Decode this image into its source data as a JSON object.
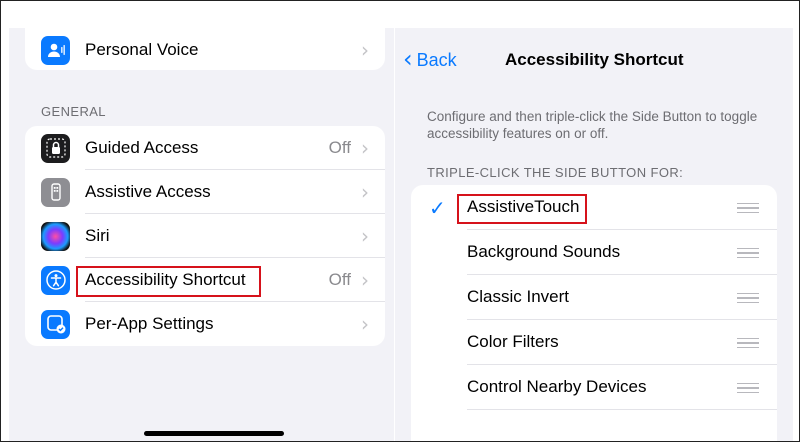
{
  "left": {
    "top_row": {
      "label": "Personal Voice",
      "icon": "personal-voice-icon"
    },
    "section_title": "GENERAL",
    "rows": [
      {
        "label": "Guided Access",
        "value": "Off",
        "icon": "lock-icon"
      },
      {
        "label": "Assistive Access",
        "value": "",
        "icon": "assistive-access-icon"
      },
      {
        "label": "Siri",
        "value": "",
        "icon": "siri-icon"
      },
      {
        "label": "Accessibility Shortcut",
        "value": "Off",
        "icon": "accessibility-icon"
      },
      {
        "label": "Per-App Settings",
        "value": "",
        "icon": "per-app-settings-icon"
      }
    ]
  },
  "right": {
    "back_label": "Back",
    "title": "Accessibility Shortcut",
    "description": "Configure and then triple-click the Side Button to toggle accessibility features on or off.",
    "section_title": "TRIPLE-CLICK THE SIDE BUTTON FOR:",
    "items": [
      {
        "label": "AssistiveTouch",
        "checked": true
      },
      {
        "label": "Background Sounds",
        "checked": false
      },
      {
        "label": "Classic Invert",
        "checked": false
      },
      {
        "label": "Color Filters",
        "checked": false
      },
      {
        "label": "Control Nearby Devices",
        "checked": false
      }
    ]
  },
  "colors": {
    "accent": "#0a7aff",
    "highlight": "#d6121b",
    "background": "#f2f2f7"
  }
}
